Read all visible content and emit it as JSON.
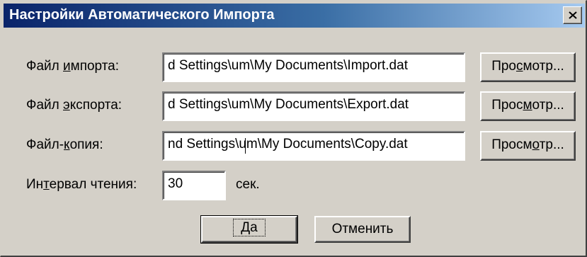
{
  "dialog": {
    "title": "Настройки Автоматического Импорта"
  },
  "rows": {
    "import": {
      "label_pre": "Файл ",
      "label_hot": "и",
      "label_post": "мпорта:",
      "value": "d Settings\\um\\My Documents\\Import.dat",
      "browse_pre": "Про",
      "browse_hot": "с",
      "browse_post": "мотр..."
    },
    "export": {
      "label_pre": "Файл ",
      "label_hot": "э",
      "label_post": "кспорта:",
      "value": "d Settings\\um\\My Documents\\Export.dat",
      "browse_pre": "Прос",
      "browse_hot": "м",
      "browse_post": "отр..."
    },
    "copy": {
      "label_pre": "Файл-",
      "label_hot": "к",
      "label_post": "опия:",
      "value": "nd Settings\\um\\My Documents\\Copy.dat",
      "browse_pre": "Просм",
      "browse_hot": "о",
      "browse_post": "тр..."
    },
    "interval": {
      "label_pre": "Ин",
      "label_hot": "т",
      "label_post": "ервал чтения:",
      "value": "30",
      "unit": "сек."
    }
  },
  "buttons": {
    "ok": "Да",
    "cancel": "Отменить"
  }
}
